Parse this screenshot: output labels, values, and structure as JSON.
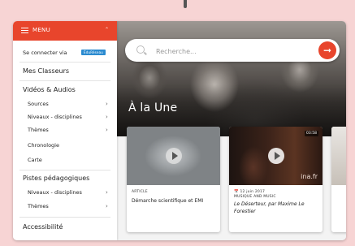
{
  "menu": {
    "label": "MENU",
    "connect_label": "Se connecter via",
    "connect_badge": "ÉduRéseau",
    "classeurs": "Mes Classeurs",
    "videos_audios": "Vidéos & Audios",
    "videos_items": [
      {
        "label": "Sources",
        "has_chevron": true
      },
      {
        "label": "Niveaux - disciplines",
        "has_chevron": true
      },
      {
        "label": "Thèmes",
        "has_chevron": true
      },
      {
        "label": "Chronologie",
        "has_chevron": false
      },
      {
        "label": "Carte",
        "has_chevron": false
      }
    ],
    "pistes": "Pistes pédagogiques",
    "pistes_items": [
      {
        "label": "Niveaux - disciplines",
        "has_chevron": true
      },
      {
        "label": "Thèmes",
        "has_chevron": true
      }
    ],
    "accessibilite": "Accessibilité"
  },
  "search": {
    "placeholder": "Recherche...",
    "button_icon": "arrow-right-icon"
  },
  "main": {
    "section_title": "À la Une",
    "cards": [
      {
        "meta": "ARTICLE",
        "title": "Démarche scientifique et EMI"
      },
      {
        "meta": "12 juin 2017",
        "sub": "MUSIQUE AND MUSIC",
        "title": "Le Déserteur, par Maxime Le Forestier",
        "duration": "03:58",
        "watermark": "ina.fr"
      }
    ]
  },
  "colors": {
    "accent": "#e8452c",
    "badge": "#2b8bd0",
    "background": "#f7d4d4"
  }
}
